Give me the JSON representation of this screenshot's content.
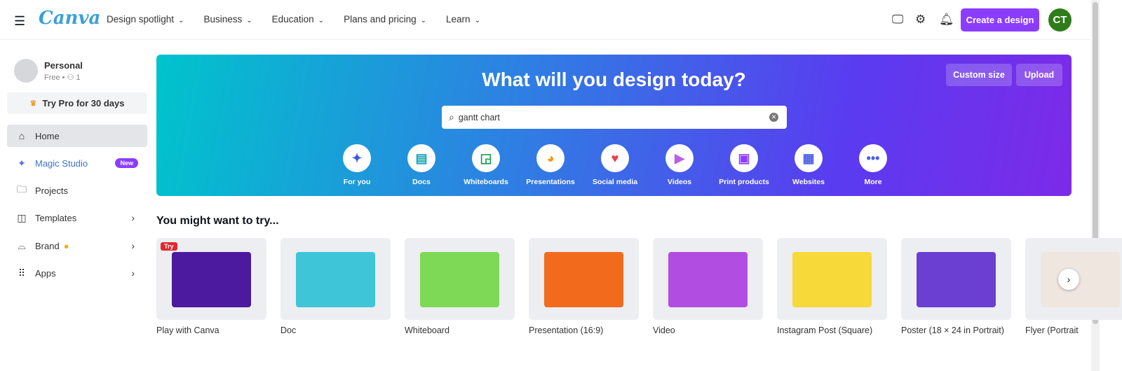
{
  "header": {
    "logo": "Canva",
    "nav": [
      "Design spotlight",
      "Business",
      "Education",
      "Plans and pricing",
      "Learn"
    ],
    "create_label": "Create a design",
    "avatar_initials": "CT"
  },
  "sidebar": {
    "account_name": "Personal",
    "account_sub": "Free • ⚇ 1",
    "try_pro": "Try Pro for 30 days",
    "items": [
      {
        "label": "Home",
        "icon": "home-icon"
      },
      {
        "label": "Magic Studio",
        "icon": "sparkle-icon",
        "badge": "New"
      },
      {
        "label": "Projects",
        "icon": "folder-icon"
      },
      {
        "label": "Templates",
        "icon": "template-icon"
      },
      {
        "label": "Brand",
        "icon": "brand-icon"
      },
      {
        "label": "Apps",
        "icon": "apps-icon"
      }
    ]
  },
  "hero": {
    "title": "What will you design today?",
    "custom_size": "Custom size",
    "upload": "Upload",
    "search_value": "gantt chart",
    "categories": [
      {
        "label": "For you",
        "color": "#3a5be8"
      },
      {
        "label": "Docs",
        "color": "#13a3b5"
      },
      {
        "label": "Whiteboards",
        "color": "#1f9e57"
      },
      {
        "label": "Presentations",
        "color": "#f29a0e"
      },
      {
        "label": "Social media",
        "color": "#ef3d4b"
      },
      {
        "label": "Videos",
        "color": "#b85ee8"
      },
      {
        "label": "Print products",
        "color": "#8b3dff"
      },
      {
        "label": "Websites",
        "color": "#4a5de8"
      },
      {
        "label": "More",
        "color": "#4a5de8"
      }
    ]
  },
  "suggestions": {
    "title": "You might want to try...",
    "try_badge": "Try",
    "items": [
      {
        "label": "Play with Canva",
        "color": "#4b1a9e"
      },
      {
        "label": "Doc",
        "color": "#3ec6d8"
      },
      {
        "label": "Whiteboard",
        "color": "#7ed957"
      },
      {
        "label": "Presentation (16:9)",
        "color": "#f26b1d"
      },
      {
        "label": "Video",
        "color": "#b14de0"
      },
      {
        "label": "Instagram Post (Square)",
        "color": "#f7d93a"
      },
      {
        "label": "Poster (18 × 24 in Portrait)",
        "color": "#6a3fd1"
      },
      {
        "label": "Flyer (Portrait",
        "color": "#f0e6e0"
      }
    ]
  }
}
